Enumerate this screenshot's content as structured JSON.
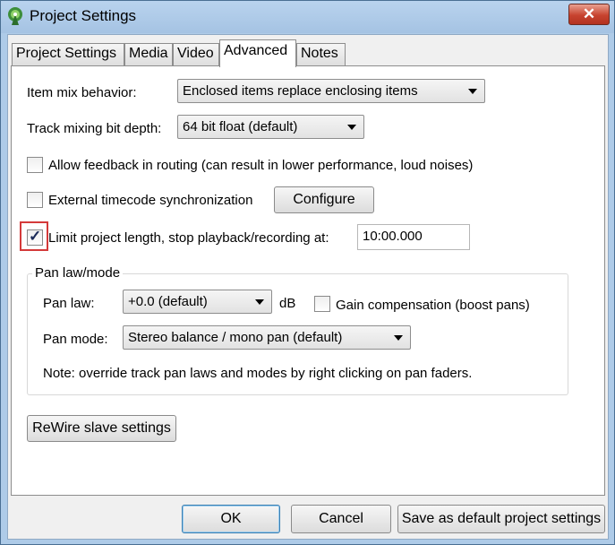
{
  "window": {
    "title": "Project Settings",
    "close_label": "✕"
  },
  "tabs": [
    {
      "label": "Project Settings",
      "active": false
    },
    {
      "label": "Media",
      "active": false
    },
    {
      "label": "Video",
      "active": false
    },
    {
      "label": "Advanced",
      "active": true
    },
    {
      "label": "Notes",
      "active": false
    }
  ],
  "advanced": {
    "item_mix": {
      "label": "Item mix behavior:",
      "value": "Enclosed items replace enclosing items"
    },
    "bit_depth": {
      "label": "Track mixing bit depth:",
      "value": "64 bit float (default)"
    },
    "allow_feedback": {
      "label": "Allow feedback in routing (can result in lower performance, loud noises)",
      "checked": false
    },
    "external_timecode": {
      "label": "External timecode synchronization",
      "checked": false,
      "configure_label": "Configure"
    },
    "limit_length": {
      "label": "Limit project length, stop playback/recording at:",
      "checked": true,
      "value": "10:00.000"
    },
    "pan": {
      "group_title": "Pan law/mode",
      "pan_law_label": "Pan law:",
      "pan_law_value": "+0.0 (default)",
      "db_unit": "dB",
      "gain_comp": {
        "label": "Gain compensation (boost pans)",
        "checked": false
      },
      "pan_mode_label": "Pan mode:",
      "pan_mode_value": "Stereo balance / mono pan (default)",
      "note": "Note: override track pan laws and modes by right clicking on pan faders."
    },
    "rewire_label": "ReWire slave settings"
  },
  "footer": {
    "ok_label": "OK",
    "cancel_label": "Cancel",
    "save_default_label": "Save as default project settings"
  },
  "colors": {
    "highlight": "#d43a3a",
    "close_button": "#c7432f",
    "check_mark": "#1c2b59"
  }
}
